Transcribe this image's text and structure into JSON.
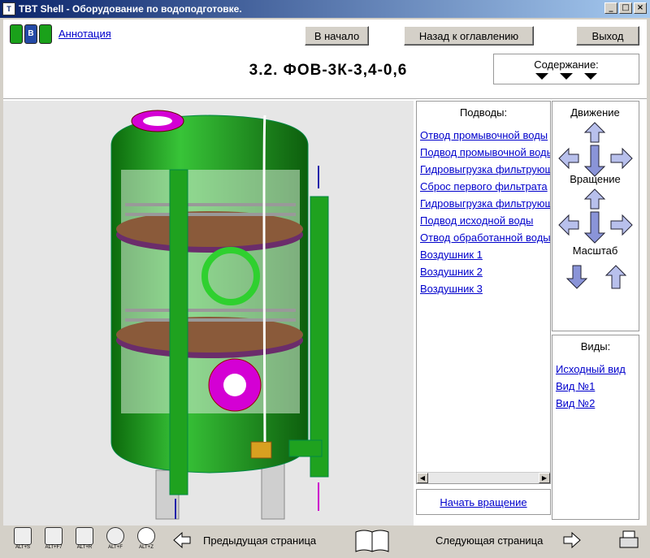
{
  "window": {
    "title": "TBT Shell - Оборудование по водоподготовке.",
    "icon": "app-icon"
  },
  "header": {
    "annotation_link": "Аннотация",
    "buttons": {
      "home": "В начало",
      "back_to_toc": "Назад к оглавлению",
      "exit": "Выход"
    },
    "page_title": "3.2. ФОВ-3К-3,4-0,6",
    "contents_label": "Содержание:"
  },
  "connections": {
    "title": "Подводы:",
    "items": [
      "Отвод промывочной воды",
      "Подвод промывочной воды",
      "Гидровыгрузка фильтрующего материала",
      "Сброс первого фильтрата",
      "Гидровыгрузка фильтрующего материала",
      "Подвод исходной воды",
      "Отвод обработанной воды",
      "Воздушник 1",
      "Воздушник 2",
      "Воздушник 3"
    ],
    "rotate_button": "Начать вращение"
  },
  "controls": {
    "movement": "Движение",
    "rotation": "Вращение",
    "scale": "Масштаб"
  },
  "views": {
    "title": "Виды:",
    "items": [
      "Исходный вид",
      "Вид №1",
      "Вид №2"
    ]
  },
  "footer": {
    "tools": [
      "ALT+S",
      "ALT+F7",
      "ALT+R",
      "ALT+F",
      "ALT+Z"
    ],
    "prev_page": "Предыдущая страница",
    "next_page": "Следующая страница"
  },
  "colors": {
    "vessel": "#1fa21f",
    "flange": "#d400d4",
    "link": "#0000cc",
    "titlebar": "#0a246a"
  }
}
